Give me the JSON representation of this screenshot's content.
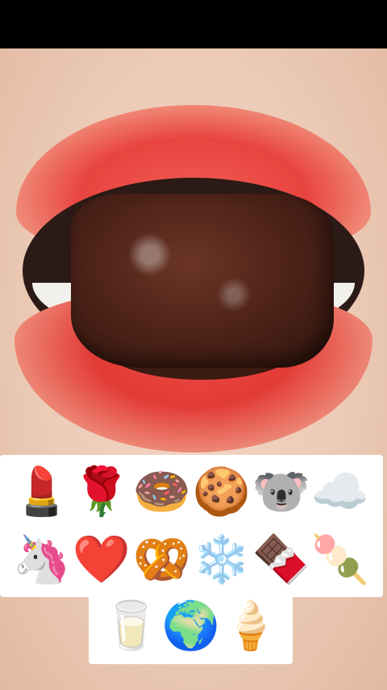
{
  "emoji_keyboard": {
    "row1": [
      {
        "name": "lipstick-icon",
        "glyph": "💄"
      },
      {
        "name": "rose-icon",
        "glyph": "🌹"
      },
      {
        "name": "donut-icon",
        "glyph": "🍩"
      },
      {
        "name": "cookie-icon",
        "glyph": "🍪"
      },
      {
        "name": "koala-icon",
        "glyph": "🐨"
      },
      {
        "name": "cloud-icon",
        "glyph": "☁️"
      }
    ],
    "row2": [
      {
        "name": "unicorn-icon",
        "glyph": "🦄"
      },
      {
        "name": "heart-icon",
        "glyph": "❤️"
      },
      {
        "name": "pretzel-icon",
        "glyph": "🥨"
      },
      {
        "name": "snowflake-icon",
        "glyph": "❄️"
      },
      {
        "name": "chocolate-bar-icon",
        "glyph": "🍫"
      },
      {
        "name": "dango-icon",
        "glyph": "🍡"
      }
    ],
    "row3": [
      {
        "name": "milk-glass-icon",
        "glyph": "🥛"
      },
      {
        "name": "earth-globe-icon",
        "glyph": "🌍"
      },
      {
        "name": "ice-cream-icon",
        "glyph": "🍦"
      }
    ]
  }
}
